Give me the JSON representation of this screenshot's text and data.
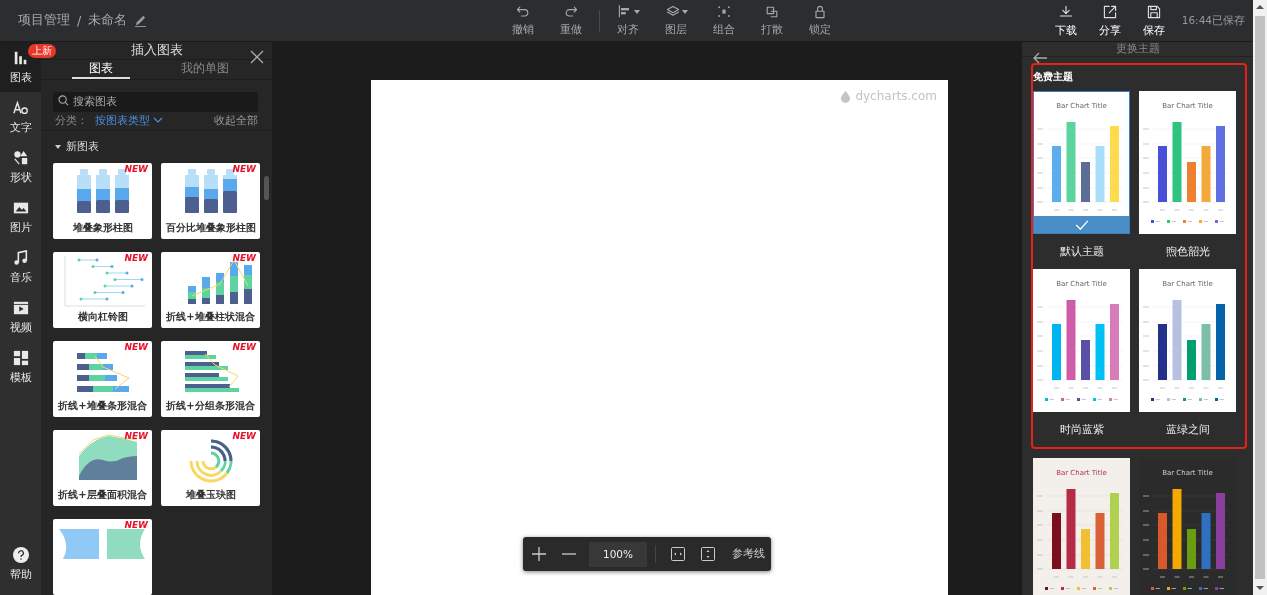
{
  "header": {
    "project": "项目管理",
    "separator": "/",
    "title": "未命名"
  },
  "toolbar": {
    "groups": [
      [
        {
          "kind": "undo",
          "label": "撤销",
          "dropdown": false
        },
        {
          "kind": "redo",
          "label": "重做",
          "dropdown": false
        }
      ],
      [
        {
          "kind": "align",
          "label": "对齐",
          "dropdown": true
        },
        {
          "kind": "layers",
          "label": "图层",
          "dropdown": true
        },
        {
          "kind": "group",
          "label": "组合",
          "dropdown": false
        },
        {
          "kind": "ungroup",
          "label": "打散",
          "dropdown": false
        },
        {
          "kind": "lock",
          "label": "锁定",
          "dropdown": false
        }
      ]
    ]
  },
  "actions": [
    {
      "kind": "download",
      "label": "下载"
    },
    {
      "kind": "share",
      "label": "分享"
    },
    {
      "kind": "save",
      "label": "保存"
    }
  ],
  "save_status": "16:44已保存",
  "rail": {
    "items": [
      {
        "kind": "chart",
        "label": "图表",
        "selected": true,
        "badge": "上新"
      },
      {
        "kind": "text",
        "label": "文字",
        "selected": false
      },
      {
        "kind": "shape",
        "label": "形状",
        "selected": false
      },
      {
        "kind": "image",
        "label": "图片",
        "selected": false
      },
      {
        "kind": "music",
        "label": "音乐",
        "selected": false
      },
      {
        "kind": "video",
        "label": "视频",
        "selected": false
      },
      {
        "kind": "template",
        "label": "模板",
        "selected": false
      }
    ],
    "help": {
      "label": "帮助"
    }
  },
  "insert_panel": {
    "title": "插入图表",
    "tabs": [
      {
        "label": "图表",
        "selected": true
      },
      {
        "label": "我的单图",
        "selected": false
      }
    ],
    "search": {
      "placeholder": "搜索图表"
    },
    "filter": {
      "label": "分类：",
      "value": "按图表类型",
      "action": "收起全部"
    },
    "section": {
      "title": "新图表",
      "expanded": true,
      "templates": [
        {
          "kind": "bottle",
          "label": "堆叠象形柱图",
          "badge": "NEW"
        },
        {
          "kind": "bottle-percent",
          "label": "百分比堆叠象形柱图",
          "badge": "NEW"
        },
        {
          "kind": "dumbbell",
          "label": "横向杠铃图",
          "badge": "NEW"
        },
        {
          "kind": "line-stacked-column",
          "label": "折线+堆叠柱状混合",
          "badge": "NEW"
        },
        {
          "kind": "line-stacked-bar",
          "label": "折线+堆叠条形混合",
          "badge": "NEW"
        },
        {
          "kind": "line-grouped-bar",
          "label": "折线+分组条形混合",
          "badge": "NEW"
        },
        {
          "kind": "line-stacked-area",
          "label": "折线+层叠面积混合",
          "badge": "NEW"
        },
        {
          "kind": "stacked-radial",
          "label": "堆叠玉玦图",
          "badge": "NEW"
        },
        {
          "kind": "butterfly",
          "badge": "NEW"
        }
      ]
    }
  },
  "canvas": {
    "brand": "dycharts.com"
  },
  "zoom_bar": {
    "zoom": "100%",
    "guides": "参考线"
  },
  "theme_panel": {
    "title": "更换主题",
    "free": {
      "title": "免费主题",
      "themes": [
        {
          "name": "默认主题",
          "kind": "light",
          "selected": true,
          "chart_title": "Bar Chart Title"
        },
        {
          "name": "煦色韶光",
          "kind": "light",
          "selected": false,
          "chart_title": "Bar Chart Title"
        },
        {
          "name": "时尚蓝紫",
          "kind": "light",
          "selected": false,
          "chart_title": "Bar Chart Title"
        },
        {
          "name": "蓝绿之间",
          "kind": "light",
          "selected": false,
          "chart_title": "Bar Chart Title"
        }
      ]
    },
    "more": {
      "themes": [
        {
          "kind": "cream",
          "selected": false,
          "chart_title": "Bar Chart Title"
        },
        {
          "kind": "dark",
          "selected": false,
          "chart_title": "Bar Chart Title"
        }
      ]
    }
  }
}
